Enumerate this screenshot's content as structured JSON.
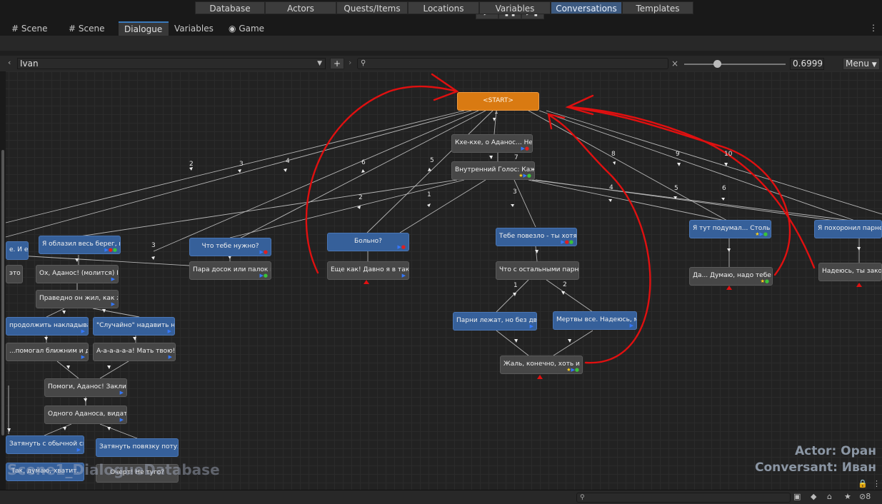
{
  "toolbar": {
    "play": "▶",
    "pause": "❚❚",
    "step": "▶❚"
  },
  "tabs": [
    {
      "label": "Scene",
      "icon": "grid-icon"
    },
    {
      "label": "Scene",
      "icon": "grid-icon"
    },
    {
      "label": "Dialogue",
      "active": true
    },
    {
      "label": "Variables"
    },
    {
      "label": "Game",
      "icon": "gamepad-icon"
    }
  ],
  "db_tabs": [
    "Database",
    "Actors",
    "Quests/Items",
    "Locations",
    "Variables",
    "Conversations",
    "Templates"
  ],
  "db_active": "Conversations",
  "conversation": {
    "selected": "Ivan",
    "add_label": "+",
    "search_placeholder": "",
    "zoom": "0.6999",
    "menu_label": "Menu"
  },
  "nodes": {
    "start": "<START>",
    "n1": "Кхе-кхе, о Аданос... Не по",
    "n7": "Внутренний Голос: Кажется,",
    "n_lucky": "Тебе повезло - ты хотя бы",
    "n_others": "Что с остальными парнями?",
    "n_lying": "Парни лежат, но без движен",
    "n_dead": "Мертвы все. Надеюсь, мы им",
    "n_pity": "Жаль, конечно, хоть и не в",
    "n_hurt": "Больно?",
    "n_still": "Еще как! Давно я в такую з",
    "n_need": "Что тебе нужно?",
    "n_planks": "Пара досок или палок каких",
    "n_thought": "Я тут подумал... Столько",
    "n_yes": "Да... Думаю, надо тебе эт",
    "n_buried": "Я похоронил парней. П",
    "n_hope": "Надеюсь, ты закопал",
    "n_shore": "Я облазил весь берег, и не",
    "n_andmore": "е. И еще",
    "n_eto": "это б",
    "n_prays": "Ох, Аданос! (молится) Благ",
    "n_righteous": "Праведно он жил, как же. В",
    "n_continue": "продолжить накладывать шин",
    "n_accident": "\"Случайно\" надавить на ран",
    "n_helped": "...помогал ближним и дальн",
    "n_aaa": "А-а-а-а-а-а! Мать твою! Б",
    "n_help": "Помоги, Аданос! Заклинаю т",
    "n_one": "Одного Аданоса, видать, ем",
    "n_tighten": "Затянуть с обычной силой",
    "n_tighter": "Затянуть повязку потуже",
    "n_enough": "Так, думаю, хватит.",
    "n_tight": "Очерт! Не туго?"
  },
  "labels": {
    "e1": "1",
    "e2": "2",
    "e3": "3",
    "e4": "4",
    "e5": "5",
    "e6": "6",
    "e7": "7",
    "e8": "8",
    "e9": "9",
    "e10": "10",
    "e2b": "2",
    "e1b": "1",
    "e3b": "3",
    "e4b": "4",
    "e5b": "5",
    "e6b": "6",
    "e1c": "1",
    "e2c": "2",
    "e3c": "3"
  },
  "overlay": {
    "asset": "Scene1_DialogueDatabase",
    "actor": "Actor: Оран",
    "conversant": "Conversant: Иван"
  },
  "statusbar": {
    "search_placeholder": "",
    "count": "8"
  },
  "colors": {
    "accent_tab": "#3a79bb",
    "start_node": "#d97a12",
    "player_node": "#36609a",
    "npc_node": "#474747",
    "annotation": "#e01010"
  }
}
